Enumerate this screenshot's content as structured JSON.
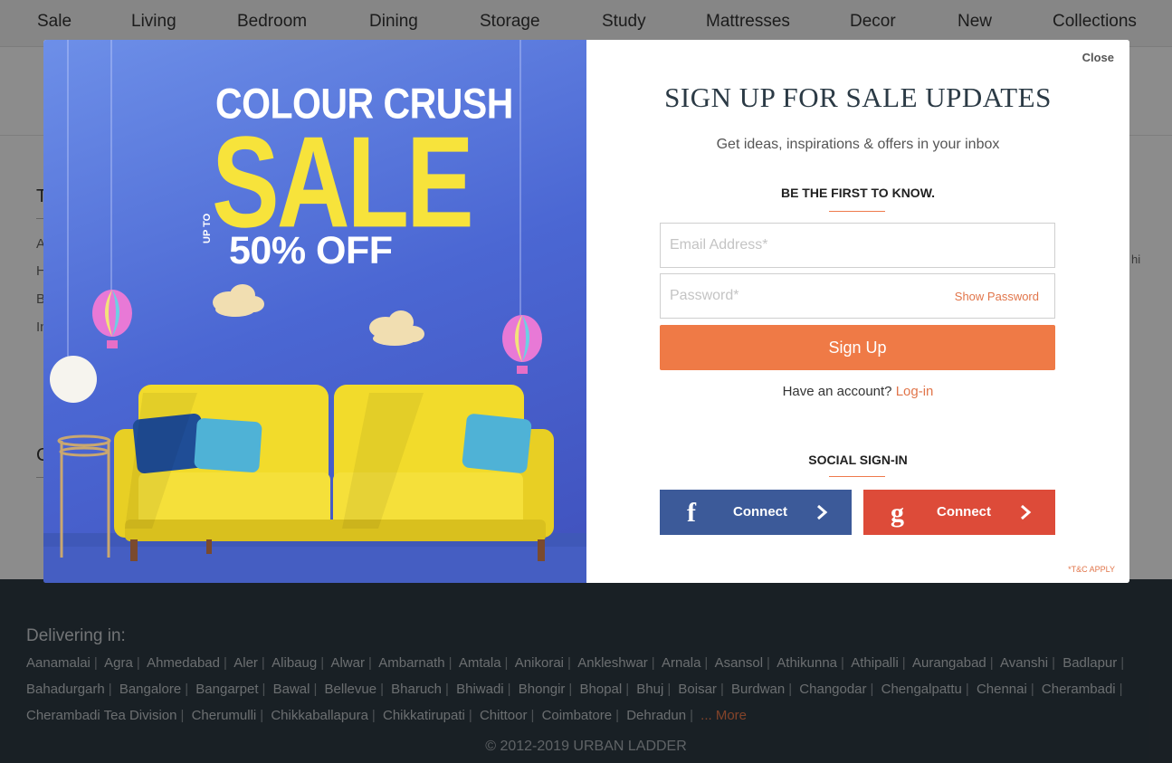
{
  "nav": {
    "items": [
      "Sale",
      "Living",
      "Bedroom",
      "Dining",
      "Storage",
      "Study",
      "Mattresses",
      "Decor",
      "New",
      "Collections"
    ]
  },
  "modal": {
    "close_label": "Close",
    "title": "SIGN UP FOR SALE UPDATES",
    "subtitle": "Get ideas, inspirations & offers in your inbox",
    "first_to_know": "BE THE FIRST TO KNOW.",
    "email_placeholder": "Email Address*",
    "password_placeholder": "Password*",
    "show_password": "Show Password",
    "signup_label": "Sign Up",
    "have_account": "Have an account?",
    "login_label": "Log-in",
    "social_heading": "SOCIAL SIGN-IN",
    "facebook": {
      "glyph": "f",
      "label": "Connect",
      "color": "#3c5a99"
    },
    "google": {
      "glyph": "g",
      "label": "Connect",
      "color": "#dd4b39"
    },
    "tnc": "*T&C APPLY"
  },
  "promo": {
    "line1": "COLOUR CRUSH",
    "line2": "SALE",
    "upto": "UP TO",
    "discount": "50% OFF",
    "colors": {
      "sale": "#f7e33b",
      "sofa": "#f2db2b",
      "background": "#4b67d3"
    }
  },
  "footer": {
    "delivering_title": "Delivering in:",
    "cities": [
      "Aanamalai",
      "Agra",
      "Ahmedabad",
      "Aler",
      "Alibaug",
      "Alwar",
      "Ambarnath",
      "Amtala",
      "Anikorai",
      "Ankleshwar",
      "Arnala",
      "Asansol",
      "Athikunna",
      "Athipalli",
      "Aurangabad",
      "Avanshi",
      "Badlapur",
      "Bahadurgarh",
      "Bangalore",
      "Bangarpet",
      "Bawal",
      "Bellevue",
      "Bharuch",
      "Bhiwadi",
      "Bhongir",
      "Bhopal",
      "Bhuj",
      "Boisar",
      "Burdwan",
      "Changodar",
      "Chengalpattu",
      "Chennai",
      "Cherambadi",
      "Cherambadi Tea Division",
      "Cherumulli",
      "Chikkaballapura",
      "Chikkatirupati",
      "Chittoor",
      "Coimbatore",
      "Dehradun"
    ],
    "more_label": "... More",
    "copyright": "© 2012-2019 URBAN LADDER"
  },
  "colors": {
    "accent": "#ef7a46",
    "footer_bg": "#2f3b44"
  }
}
